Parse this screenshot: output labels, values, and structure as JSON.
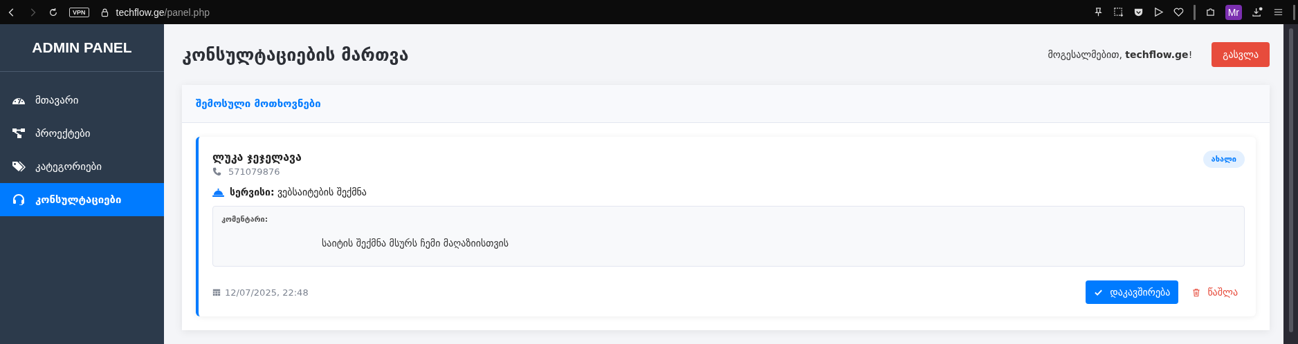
{
  "browser": {
    "url_host": "techflow.ge",
    "url_path": "/panel.php",
    "vpn_badge": "VPN",
    "profile": "Mr"
  },
  "sidebar": {
    "title": "ADMIN PANEL",
    "items": [
      {
        "label": "მთავარი",
        "kind": "gauge",
        "selected": false
      },
      {
        "label": "პროექტები",
        "kind": "sitemap",
        "selected": false
      },
      {
        "label": "კატეგორიები",
        "kind": "tags",
        "selected": false
      },
      {
        "label": "კონსულტაციები",
        "kind": "headset",
        "selected": true
      }
    ]
  },
  "header": {
    "title": "კონსულტაციების მართვა",
    "welcome": "მოგესალმებით, **techflow.ge**!",
    "logout": "გასვლა"
  },
  "panel": {
    "title": "შემოსული მოთხოვნები",
    "requests": [
      {
        "name": "ლუკა ჯეჯელავა",
        "phone": "571079876",
        "status": "ახალი",
        "service_label": "სერვისი:",
        "service": "ვებსაიტების შექმნა",
        "comment_label": "კომენტარი:",
        "comment": "საიტის შექმნა მსურს ჩემი მაღაზიისთვის",
        "date": "12/07/2025, 22:48",
        "actions": [
          {
            "kind": "confirm",
            "label": "დაკავშირება"
          },
          {
            "kind": "delete",
            "label": "წაშლა"
          }
        ]
      }
    ]
  }
}
